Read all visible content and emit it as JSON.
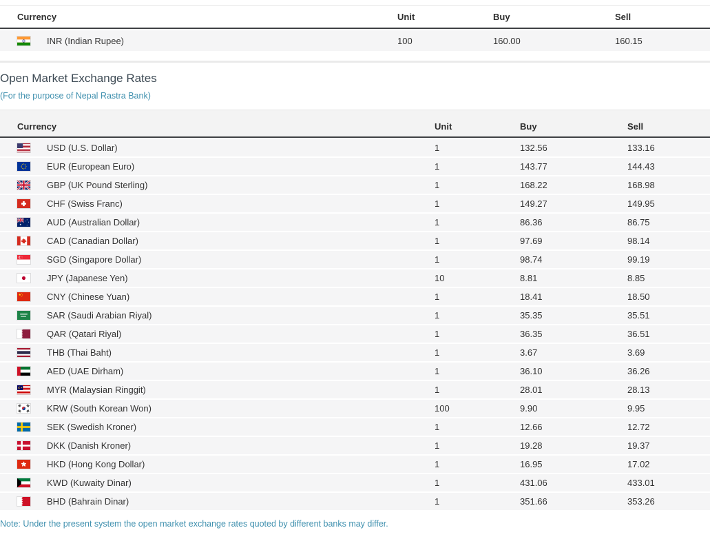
{
  "colors": {
    "row_background": "#f5f5f6",
    "header_band_background": "#f3f3f3",
    "header_dark_border": "#3e4043",
    "light_border": "#e4e4e4",
    "heading_text": "#3e4b55",
    "accent_teal": "#4191af",
    "body_text": "#333333"
  },
  "inr_table": {
    "columns": [
      "Currency",
      "Unit",
      "Buy",
      "Sell"
    ],
    "rows": [
      {
        "flag": "in",
        "name": "INR (Indian Rupee)",
        "unit": "100",
        "buy": "160.00",
        "sell": "160.15"
      }
    ]
  },
  "section": {
    "title": "Open Market Exchange Rates",
    "subtitle": "(For the purpose of Nepal Rastra Bank)"
  },
  "open_market_table": {
    "columns": [
      "Currency",
      "Unit",
      "Buy",
      "Sell"
    ],
    "rows": [
      {
        "flag": "us",
        "name": "USD (U.S. Dollar)",
        "unit": "1",
        "buy": "132.56",
        "sell": "133.16"
      },
      {
        "flag": "eu",
        "name": "EUR (European Euro)",
        "unit": "1",
        "buy": "143.77",
        "sell": "144.43"
      },
      {
        "flag": "gb",
        "name": "GBP (UK Pound Sterling)",
        "unit": "1",
        "buy": "168.22",
        "sell": "168.98"
      },
      {
        "flag": "ch",
        "name": "CHF (Swiss Franc)",
        "unit": "1",
        "buy": "149.27",
        "sell": "149.95"
      },
      {
        "flag": "au",
        "name": "AUD (Australian Dollar)",
        "unit": "1",
        "buy": "86.36",
        "sell": "86.75"
      },
      {
        "flag": "ca",
        "name": "CAD (Canadian Dollar)",
        "unit": "1",
        "buy": "97.69",
        "sell": "98.14"
      },
      {
        "flag": "sg",
        "name": "SGD (Singapore Dollar)",
        "unit": "1",
        "buy": "98.74",
        "sell": "99.19"
      },
      {
        "flag": "jp",
        "name": "JPY (Japanese Yen)",
        "unit": "10",
        "buy": "8.81",
        "sell": "8.85"
      },
      {
        "flag": "cn",
        "name": "CNY (Chinese Yuan)",
        "unit": "1",
        "buy": "18.41",
        "sell": "18.50"
      },
      {
        "flag": "sa",
        "name": "SAR (Saudi Arabian Riyal)",
        "unit": "1",
        "buy": "35.35",
        "sell": "35.51"
      },
      {
        "flag": "qa",
        "name": "QAR (Qatari Riyal)",
        "unit": "1",
        "buy": "36.35",
        "sell": "36.51"
      },
      {
        "flag": "th",
        "name": "THB (Thai Baht)",
        "unit": "1",
        "buy": "3.67",
        "sell": "3.69"
      },
      {
        "flag": "ae",
        "name": "AED (UAE Dirham)",
        "unit": "1",
        "buy": "36.10",
        "sell": "36.26"
      },
      {
        "flag": "my",
        "name": "MYR (Malaysian Ringgit)",
        "unit": "1",
        "buy": "28.01",
        "sell": "28.13"
      },
      {
        "flag": "kr",
        "name": "KRW (South Korean Won)",
        "unit": "100",
        "buy": "9.90",
        "sell": "9.95"
      },
      {
        "flag": "se",
        "name": "SEK (Swedish Kroner)",
        "unit": "1",
        "buy": "12.66",
        "sell": "12.72"
      },
      {
        "flag": "dk",
        "name": "DKK (Danish Kroner)",
        "unit": "1",
        "buy": "19.28",
        "sell": "19.37"
      },
      {
        "flag": "hk",
        "name": "HKD (Hong Kong Dollar)",
        "unit": "1",
        "buy": "16.95",
        "sell": "17.02"
      },
      {
        "flag": "kw",
        "name": "KWD (Kuwaity Dinar)",
        "unit": "1",
        "buy": "431.06",
        "sell": "433.01"
      },
      {
        "flag": "bh",
        "name": "BHD (Bahrain Dinar)",
        "unit": "1",
        "buy": "351.66",
        "sell": "353.26"
      }
    ]
  },
  "note": "Note: Under the present system the open market exchange rates quoted by different banks may differ."
}
